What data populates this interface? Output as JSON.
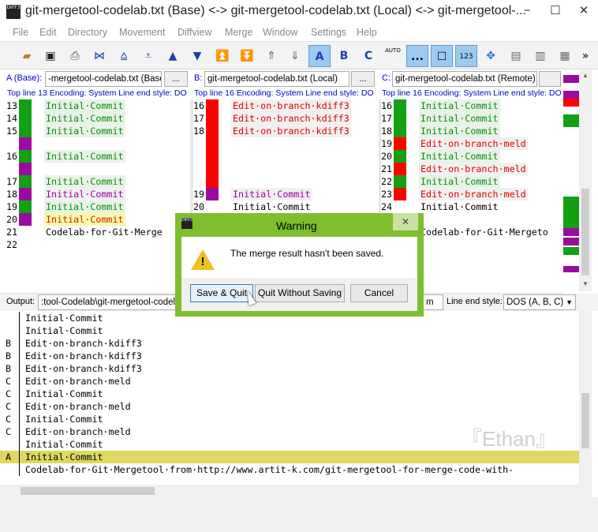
{
  "window": {
    "title": "git-mergetool-codelab.txt (Base) <-> git-mergetool-codelab.txt (Local) <-> git-mergetool-...",
    "icon_label": "DIFF3",
    "minimize": "−",
    "maximize": "☐",
    "close": "✕"
  },
  "menu": [
    "File",
    "Edit",
    "Directory",
    "Movement",
    "Diffview",
    "Merge",
    "Window",
    "Settings",
    "Help"
  ],
  "toolbar": {
    "icons": [
      "open-folder-icon",
      "save-icon",
      "print-icon",
      "goto-current-delta-icon",
      "goto-first-delta-icon",
      "goto-last-delta-icon",
      "goto-prev-delta-icon",
      "goto-next-delta-icon",
      "goto-prev-conflict-icon",
      "goto-next-conflict-icon",
      "goto-prev-unsolved-icon",
      "goto-next-unsolved-icon"
    ],
    "btn_a": "A",
    "btn_b": "B",
    "btn_c": "C",
    "btn_auto": "AUTO",
    "btn_whitespace": "...",
    "btn_lines": "123",
    "more": "»"
  },
  "files": {
    "a": {
      "label": "A (Base):",
      "name": "-mergetool-codelab.txt (Base)",
      "browse": "...",
      "info": "Top line 13 Encoding: System Line end style: DO"
    },
    "b": {
      "label": "B:",
      "name": "git-mergetool-codelab.txt (Local)",
      "browse": "...",
      "info": "Top line 16 Encoding: System Line end style: DO"
    },
    "c": {
      "label": "C:",
      "name": "git-mergetool-codelab.txt (Remote)",
      "browse": "",
      "info": "Top line 16 Encoding: System Line end style: DO"
    }
  },
  "pane_a": [
    {
      "n": "13",
      "t": "Initial·Commit",
      "c": "green"
    },
    {
      "n": "14",
      "t": "Initial·Commit",
      "c": "green"
    },
    {
      "n": "15",
      "t": "Initial·Commit",
      "c": "green"
    },
    {
      "n": "",
      "t": "",
      "c": "purple"
    },
    {
      "n": "16",
      "t": "Initial·Commit",
      "c": "green"
    },
    {
      "n": "",
      "t": "",
      "c": "purple"
    },
    {
      "n": "17",
      "t": "Initial·Commit",
      "c": "green"
    },
    {
      "n": "18",
      "t": "Initial·Commit",
      "c": "purple"
    },
    {
      "n": "19",
      "t": "Initial·Commit",
      "c": "green"
    },
    {
      "n": "20",
      "t": "Initial·Commit",
      "c": "yellow"
    },
    {
      "n": "21",
      "t": "Codelab·for·Git·Merge",
      "c": "plain"
    },
    {
      "n": "22",
      "t": "",
      "c": "none"
    }
  ],
  "pane_b": [
    {
      "n": "16",
      "t": "Edit·on·branch·kdiff3",
      "c": "red"
    },
    {
      "n": "17",
      "t": "Edit·on·branch·kdiff3",
      "c": "red"
    },
    {
      "n": "18",
      "t": "Edit·on·branch·kdiff3",
      "c": "red"
    },
    {
      "n": "",
      "t": "",
      "c": "red"
    },
    {
      "n": "",
      "t": "",
      "c": "red"
    },
    {
      "n": "",
      "t": "",
      "c": "red"
    },
    {
      "n": "",
      "t": "",
      "c": "red"
    },
    {
      "n": "19",
      "t": "Initial·Commit",
      "c": "purple"
    },
    {
      "n": "20",
      "t": "Initial·Commit",
      "c": "plain"
    }
  ],
  "pane_c": [
    {
      "n": "16",
      "t": "Initial·Commit",
      "c": "green"
    },
    {
      "n": "17",
      "t": "Initial·Commit",
      "c": "green"
    },
    {
      "n": "18",
      "t": "Initial·Commit",
      "c": "green"
    },
    {
      "n": "19",
      "t": "Edit·on·branch·meld",
      "c": "red"
    },
    {
      "n": "20",
      "t": "Initial·Commit",
      "c": "green"
    },
    {
      "n": "21",
      "t": "Edit·on·branch·meld",
      "c": "red"
    },
    {
      "n": "22",
      "t": "Initial·Commit",
      "c": "green"
    },
    {
      "n": "23",
      "t": "Edit·on·branch·meld",
      "c": "red"
    },
    {
      "n": "24",
      "t": "Initial·Commit",
      "c": "plain"
    },
    {
      "n": "",
      "t": "",
      "c": "none"
    },
    {
      "n": "",
      "t": "Codelab·for·Git·Mergeto",
      "c": "plain"
    }
  ],
  "output": {
    "label": "Output:",
    "path": ":tool-Codelab\\git-mergetool-codelab",
    "encoding_tail": "m",
    "line_end_label": "Line end style:",
    "line_end_value": "DOS (A, B, C)",
    "lines": [
      {
        "s": "",
        "t": "Initial·Commit"
      },
      {
        "s": "",
        "t": "Initial·Commit"
      },
      {
        "s": "B",
        "t": "Edit·on·branch·kdiff3"
      },
      {
        "s": "B",
        "t": "Edit·on·branch·kdiff3"
      },
      {
        "s": "B",
        "t": "Edit·on·branch·kdiff3"
      },
      {
        "s": "C",
        "t": "Edit·on·branch·meld"
      },
      {
        "s": "C",
        "t": "Initial·Commit"
      },
      {
        "s": "C",
        "t": "Edit·on·branch·meld"
      },
      {
        "s": "C",
        "t": "Initial·Commit"
      },
      {
        "s": "C",
        "t": "Edit·on·branch·meld"
      },
      {
        "s": "",
        "t": "Initial·Commit"
      },
      {
        "s": "A",
        "t": "Initial·Commit"
      },
      {
        "s": "",
        "t": "Codelab·for·Git·Mergetool·from·http://www.artit-k.com/git-mergetool-for-merge-code-with-"
      }
    ]
  },
  "watermark": "『Ethan』",
  "dialog": {
    "title": "Warning",
    "message": "The merge result hasn't been saved.",
    "save_quit": "Save & Quit",
    "quit_without_saving": "Quit Without Saving",
    "cancel": "Cancel",
    "close": "✕"
  },
  "colors": {
    "green": "#14a014",
    "red": "#ff0000",
    "purple": "#9a0aa0",
    "yellow_hl": "#dcd860",
    "dialog_frame": "#7dbf2e",
    "info_blue": "#0000cc"
  }
}
